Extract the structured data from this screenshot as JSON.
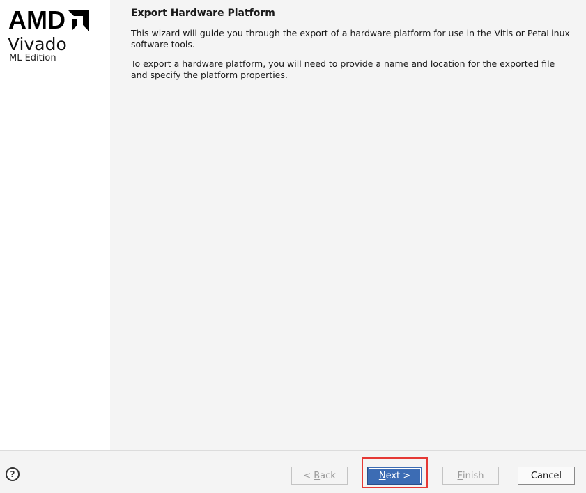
{
  "branding": {
    "company": "AMD",
    "product": "Vivado",
    "edition": "ML Edition"
  },
  "wizard": {
    "title": "Export Hardware Platform",
    "paragraphs": [
      "This wizard will guide you through the export of a hardware platform for use in the Vitis or PetaLinux software tools.",
      "To export a hardware platform, you will need to provide a name and location for the exported file and specify the platform properties."
    ]
  },
  "footer": {
    "help_label": "?",
    "back": {
      "prefix": "< ",
      "mnemonic": "B",
      "rest": "ack",
      "enabled": false
    },
    "next": {
      "mnemonic": "N",
      "rest": "ext >",
      "enabled": true
    },
    "finish": {
      "mnemonic": "F",
      "rest": "inish",
      "enabled": false
    },
    "cancel": {
      "label": "Cancel",
      "enabled": true
    }
  },
  "colors": {
    "primary_button": "#3c6cb4",
    "highlight_box": "#e53935",
    "sidebar_bg": "#ffffff",
    "content_bg": "#f4f4f4"
  }
}
